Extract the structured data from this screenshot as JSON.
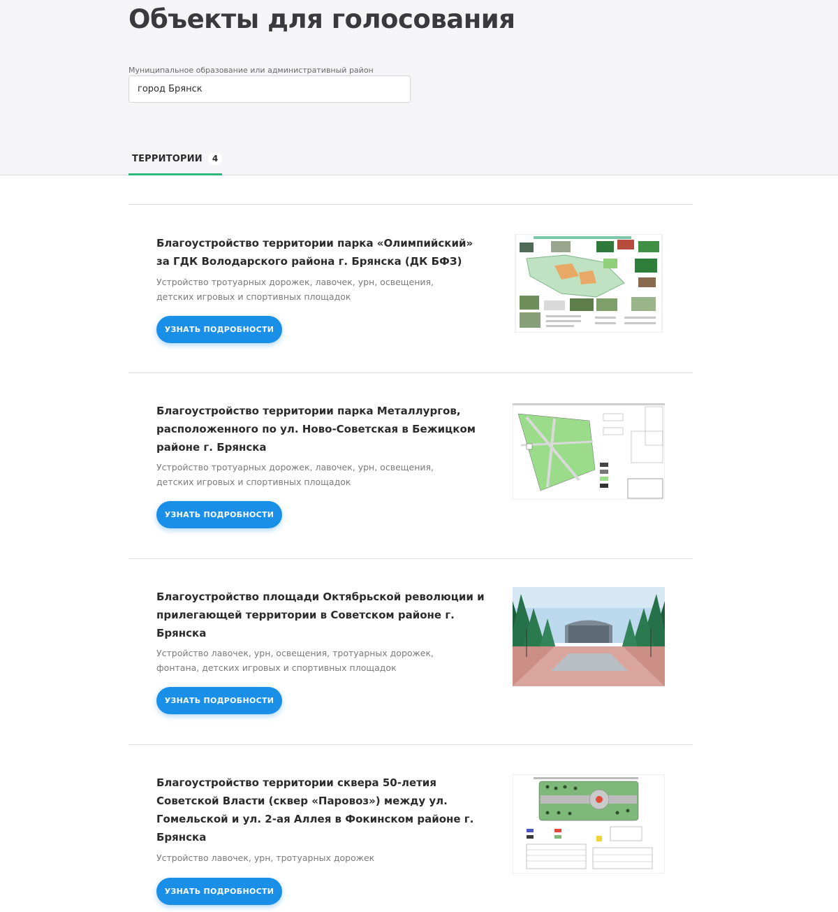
{
  "page": {
    "title": "Объекты для голосования"
  },
  "filter": {
    "label": "Муниципальное образование или административный район",
    "value": "город Брянск"
  },
  "tabs": [
    {
      "label": "ТЕРРИТОРИИ",
      "count": "4"
    }
  ],
  "items": [
    {
      "title": "Благоустройство территории парка «Олимпийский» за ГДК Володарского района г. Брянска (ДК БФЗ)",
      "description": "Устройство тротуарных дорожек, лавочек, урн, освещения, детских игровых и спортивных площадок",
      "button": "УЗНАТЬ ПОДРОБНОСТИ"
    },
    {
      "title": "Благоустройство территории парка Металлургов, расположенного по ул. Ново-Советская в Бежицком районе г. Брянска",
      "description": "Устройство тротуарных дорожек, лавочек, урн, освещения, детских игровых и спортивных площадок",
      "button": "УЗНАТЬ ПОДРОБНОСТИ"
    },
    {
      "title": "Благоустройство площади Октябрьской революции и прилегающей территории в Советском районе г. Брянска",
      "description": "Устройство лавочек, урн, освещения, тротуарных дорожек, фонтана, детских игровых и спортивных площадок",
      "button": "УЗНАТЬ ПОДРОБНОСТИ"
    },
    {
      "title": "Благоустройство территории сквера 50-летия Советской Власти (сквер «Паровоз») между ул. Гомельской и ул. 2-ая Аллея в Фокинском районе г. Брянска",
      "description": "Устройство лавочек, урн, тротуарных дорожек",
      "button": "УЗНАТЬ ПОДРОБНОСТИ"
    }
  ]
}
